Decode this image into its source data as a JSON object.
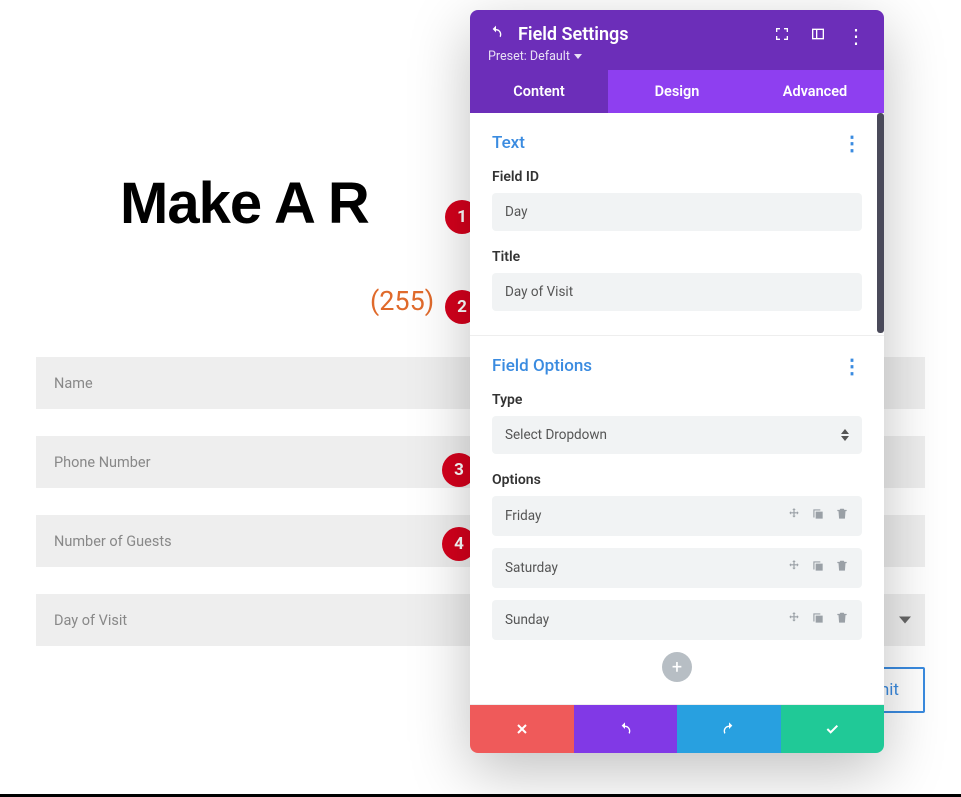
{
  "bg": {
    "title": "Make A R",
    "phone": "(255)",
    "fields": [
      "Name",
      "Phone Number",
      "Number of Guests",
      "Day of Visit"
    ],
    "submit": "mit"
  },
  "badges": [
    "1",
    "2",
    "3",
    "4"
  ],
  "panel": {
    "title": "Field Settings",
    "preset": "Preset: Default",
    "tabs": {
      "content": "Content",
      "design": "Design",
      "advanced": "Advanced"
    },
    "section_text": {
      "title": "Text",
      "fieldid_label": "Field ID",
      "fieldid_value": "Day",
      "title_label": "Title",
      "title_value": "Day of Visit"
    },
    "section_options": {
      "title": "Field Options",
      "type_label": "Type",
      "type_value": "Select Dropdown",
      "options_label": "Options",
      "options": [
        "Friday",
        "Saturday",
        "Sunday"
      ]
    }
  }
}
